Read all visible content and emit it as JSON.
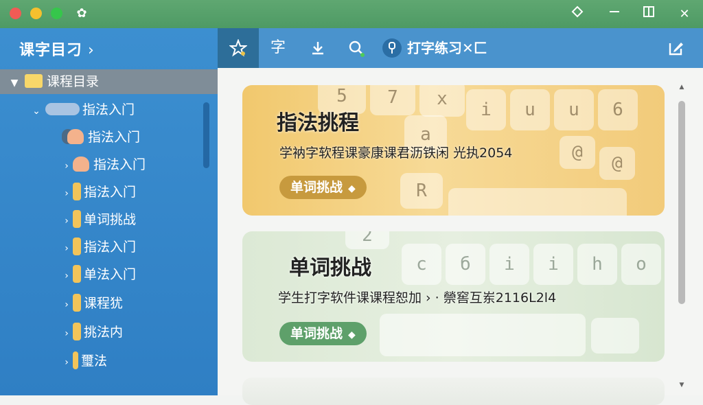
{
  "window": {
    "minimize_icon": "minimize-icon",
    "restore_icon": "restore-icon",
    "close_label": "✕"
  },
  "sidebar": {
    "title": "课字目刁",
    "title_chevron": "›",
    "root_label": "课程目录",
    "items": [
      {
        "label": "指法入门",
        "expanded": true
      },
      {
        "label": "指法入门"
      },
      {
        "label": "指法入门"
      },
      {
        "label": "指法入门"
      },
      {
        "label": "单词挑战"
      },
      {
        "label": "指法入门"
      },
      {
        "label": "单法入门"
      },
      {
        "label": "课程犹"
      },
      {
        "label": "挑法内"
      },
      {
        "label": "璽法"
      }
    ]
  },
  "toolbar": {
    "tab_active_icon": "star-keyboard-icon",
    "char_label": "字",
    "download_icon": "download-icon",
    "search_icon": "search-icon",
    "tab_label": "打字练习✕匚",
    "edit_icon": "edit-icon"
  },
  "cards": [
    {
      "title": "指法挑程",
      "desc": "学衲字软程课豪康课君沥铁闲   光执2054",
      "button": "单词挑战",
      "color": "#f1c86d"
    },
    {
      "title": "单词挑战",
      "desc": "学生打字软件课课程恕加  › · 禜窖互岽2116L2l4",
      "button": "单词挑战",
      "color": "#dce9d5"
    }
  ],
  "colors": {
    "titlebar": "#5fa771",
    "sidebar": "#3c8fd0",
    "toolbar": "#4a93cd",
    "active_tab": "#2d6e99"
  }
}
